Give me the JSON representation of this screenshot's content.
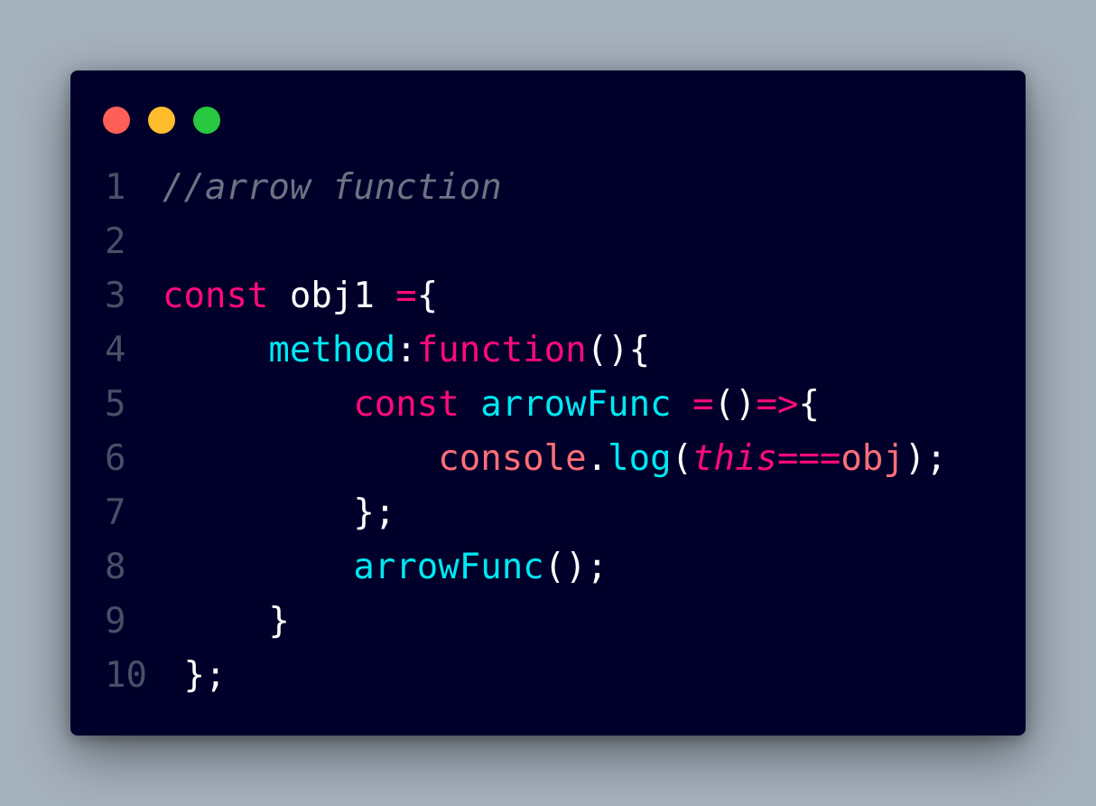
{
  "window": {
    "controls": [
      {
        "name": "close",
        "color": "#ff5f57"
      },
      {
        "name": "minimize",
        "color": "#ffbd2e"
      },
      {
        "name": "maximize",
        "color": "#28c840"
      }
    ]
  },
  "code": {
    "lines": [
      {
        "number": "1",
        "tokens": [
          {
            "text": "//arrow function",
            "type": "comment"
          }
        ]
      },
      {
        "number": "2",
        "tokens": []
      },
      {
        "number": "3",
        "tokens": [
          {
            "text": "const",
            "type": "kw"
          },
          {
            "text": " obj1 ",
            "type": "plain"
          },
          {
            "text": "=",
            "type": "kw"
          },
          {
            "text": "{",
            "type": "plain"
          }
        ]
      },
      {
        "number": "4",
        "tokens": [
          {
            "text": "     ",
            "type": "plain"
          },
          {
            "text": "method",
            "type": "prop"
          },
          {
            "text": ":",
            "type": "plain"
          },
          {
            "text": "function",
            "type": "kw"
          },
          {
            "text": "(){",
            "type": "plain"
          }
        ]
      },
      {
        "number": "5",
        "tokens": [
          {
            "text": "         ",
            "type": "plain"
          },
          {
            "text": "const",
            "type": "kw"
          },
          {
            "text": " ",
            "type": "plain"
          },
          {
            "text": "arrowFunc",
            "type": "prop"
          },
          {
            "text": " ",
            "type": "plain"
          },
          {
            "text": "=",
            "type": "kw"
          },
          {
            "text": "()",
            "type": "plain"
          },
          {
            "text": "=>",
            "type": "kw"
          },
          {
            "text": "{",
            "type": "plain"
          }
        ]
      },
      {
        "number": "6",
        "tokens": [
          {
            "text": "             ",
            "type": "plain"
          },
          {
            "text": "console",
            "type": "obj"
          },
          {
            "text": ".",
            "type": "plain"
          },
          {
            "text": "log",
            "type": "prop"
          },
          {
            "text": "(",
            "type": "plain"
          },
          {
            "text": "this",
            "type": "italic-kw"
          },
          {
            "text": "===",
            "type": "kw"
          },
          {
            "text": "obj",
            "type": "obj"
          },
          {
            "text": ");",
            "type": "plain"
          }
        ]
      },
      {
        "number": "7",
        "tokens": [
          {
            "text": "         ",
            "type": "plain"
          },
          {
            "text": "};",
            "type": "plain"
          }
        ]
      },
      {
        "number": "8",
        "tokens": [
          {
            "text": "         ",
            "type": "plain"
          },
          {
            "text": "arrowFunc",
            "type": "prop"
          },
          {
            "text": "();",
            "type": "plain"
          }
        ]
      },
      {
        "number": "9",
        "tokens": [
          {
            "text": "     ",
            "type": "plain"
          },
          {
            "text": "}",
            "type": "plain"
          }
        ]
      },
      {
        "number": "10",
        "tokens": [
          {
            "text": " ",
            "type": "plain"
          },
          {
            "text": "};",
            "type": "plain"
          }
        ]
      }
    ]
  }
}
